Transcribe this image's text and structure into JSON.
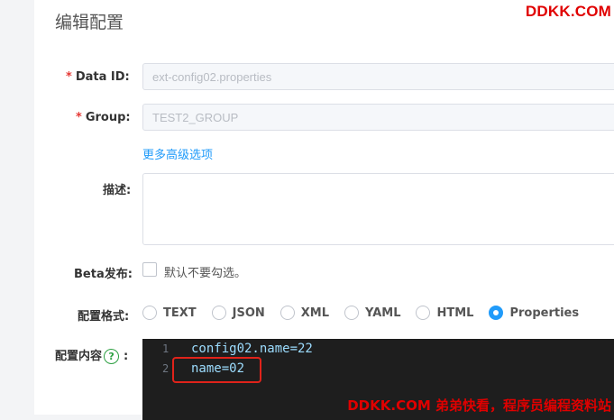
{
  "page": {
    "title": "编辑配置",
    "watermark_top": "DDKK.COM",
    "watermark_bottom": "DDKK.COM 弟弟快看，程序员编程资料站"
  },
  "form": {
    "data_id": {
      "label": "Data ID:",
      "required": "*",
      "value": "ext-config02.properties"
    },
    "group": {
      "label": "Group:",
      "required": "*",
      "value": "TEST2_GROUP"
    },
    "advanced_link": "更多高级选项",
    "description": {
      "label": "描述:",
      "value": ""
    },
    "beta": {
      "label": "Beta发布:",
      "checkbox_text": "默认不要勾选。",
      "checked": false
    },
    "format": {
      "label": "配置格式:",
      "options": [
        "TEXT",
        "JSON",
        "XML",
        "YAML",
        "HTML",
        "Properties"
      ],
      "selected": "Properties"
    },
    "content": {
      "label": "配置内容",
      "help_icon": "question-circle-icon",
      "colon": ":",
      "lines": [
        {
          "num": "1",
          "text": "config02.name=22"
        },
        {
          "num": "2",
          "text": "name=02"
        }
      ]
    }
  },
  "colors": {
    "accent": "#209bfa",
    "required": "#e53935",
    "watermark": "#e00000",
    "editor_bg": "#1e1e1e"
  }
}
